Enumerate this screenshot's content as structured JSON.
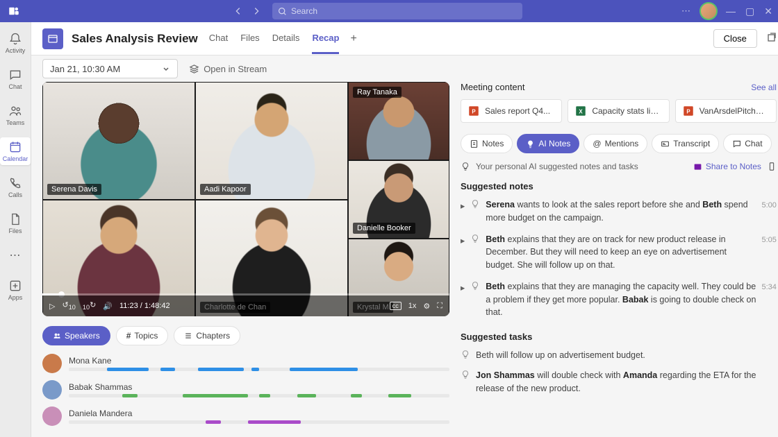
{
  "titlebar": {
    "search_placeholder": "Search"
  },
  "rail": {
    "items": [
      {
        "label": "Activity"
      },
      {
        "label": "Chat"
      },
      {
        "label": "Teams"
      },
      {
        "label": "Calendar"
      },
      {
        "label": "Calls"
      },
      {
        "label": "Files"
      }
    ],
    "apps_label": "Apps"
  },
  "header": {
    "title": "Sales Analysis Review",
    "tabs": [
      {
        "label": "Chat"
      },
      {
        "label": "Files"
      },
      {
        "label": "Details"
      },
      {
        "label": "Recap"
      }
    ],
    "close": "Close"
  },
  "toolbar": {
    "datetime": "Jan 21, 10:30 AM",
    "open_stream": "Open in Stream"
  },
  "video": {
    "participants": [
      {
        "name": "Serena Davis"
      },
      {
        "name": "Aadi Kapoor"
      },
      {
        "name": "Ray Tanaka"
      },
      {
        "name": "Danielle Booker"
      },
      {
        "name": ""
      },
      {
        "name": "Charlotte de Chan"
      },
      {
        "name": "Krystal M"
      }
    ],
    "time_current": "11:23",
    "time_total": "1:48:42",
    "speed": "1x",
    "skip_back": "10",
    "skip_fwd": "10",
    "cc": "cc"
  },
  "timeline": {
    "tabs": [
      {
        "label": "Speakers"
      },
      {
        "label": "Topics"
      },
      {
        "label": "Chapters"
      }
    ],
    "speakers": [
      {
        "name": "Mona Kane",
        "color": "#2e8fe6",
        "segs": [
          [
            10,
            11
          ],
          [
            24,
            4
          ],
          [
            34,
            12
          ],
          [
            48,
            2
          ],
          [
            58,
            18
          ]
        ]
      },
      {
        "name": "Babak Shammas",
        "color": "#5bb35b",
        "segs": [
          [
            14,
            4
          ],
          [
            30,
            17
          ],
          [
            50,
            3
          ],
          [
            60,
            5
          ],
          [
            74,
            3
          ],
          [
            84,
            6
          ]
        ]
      },
      {
        "name": "Daniela Mandera",
        "color": "#a94bc9",
        "segs": [
          [
            36,
            4
          ],
          [
            47,
            14
          ]
        ]
      }
    ]
  },
  "meeting_content": {
    "title": "Meeting content",
    "see_all": "See all",
    "files": [
      {
        "name": "Sales report Q4...",
        "type": "pptx"
      },
      {
        "name": "Capacity stats list...",
        "type": "xlsx"
      },
      {
        "name": "VanArsdelPitchDe...",
        "type": "pptx"
      }
    ]
  },
  "notes_panel": {
    "tabs": [
      {
        "label": "Notes"
      },
      {
        "label": "AI Notes"
      },
      {
        "label": "Mentions"
      },
      {
        "label": "Transcript"
      },
      {
        "label": "Chat"
      }
    ],
    "ai_hint": "Your personal AI suggested notes and tasks",
    "share": "Share to Notes",
    "suggested_notes_title": "Suggested notes",
    "notes": [
      {
        "html": "<b>Serena</b> wants to look at the sales report before she and <b>Beth</b> spend more budget on the campaign.",
        "time": "5:00"
      },
      {
        "html": "<b>Beth</b> explains that they are on track for new product release in December. But they will need to keep an eye on advertisement budget. She will follow up on that.",
        "time": "5:05"
      },
      {
        "html": "<b>Beth</b> explains that they are managing the capacity well. They could be a problem if they get more popular. <b>Babak</b> is going to double check on that.",
        "time": "5:34"
      }
    ],
    "suggested_tasks_title": "Suggested tasks",
    "tasks": [
      {
        "html": "Beth will follow up on advertisement budget."
      },
      {
        "html": "<b>Jon Shammas</b> will double check with <b>Amanda</b> regarding the ETA for the release of the new product."
      }
    ]
  }
}
